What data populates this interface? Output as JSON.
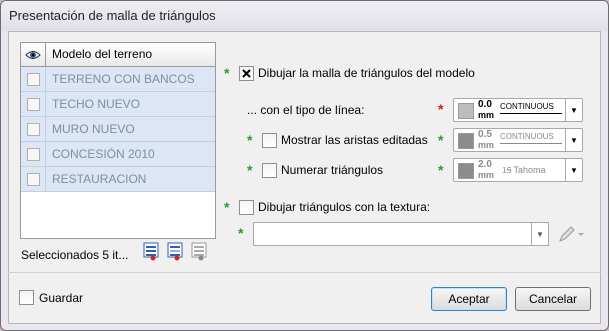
{
  "window": {
    "title": "Presentación de malla de triángulos"
  },
  "table": {
    "header": "Modelo del terreno",
    "rows": [
      {
        "label": "TERRENO CON BANCOS",
        "checked": false
      },
      {
        "label": "TECHO NUEVO",
        "checked": false
      },
      {
        "label": "MURO NUEVO",
        "checked": false
      },
      {
        "label": "CONCESIÓN 2010",
        "checked": false
      },
      {
        "label": "RESTAURACION",
        "checked": false
      }
    ]
  },
  "selection_info": "Seleccionados 5 it...",
  "options": {
    "draw_model": {
      "label": "Dibujar la malla de triángulos del modelo",
      "checked": true
    },
    "line_type": {
      "label": "... con el tipo de línea:"
    },
    "show_edited": {
      "label": "Mostrar las aristas editadas",
      "checked": false
    },
    "number_triangles": {
      "label": "Numerar triángulos",
      "checked": false
    },
    "draw_texture": {
      "label": "Dibujar triángulos con la textura:",
      "checked": false
    }
  },
  "line_selectors": {
    "main": {
      "value": "0.0",
      "unit": "mm",
      "linetype": "CONTINUOUS"
    },
    "edited": {
      "value": "0.5",
      "unit": "mm",
      "linetype": "CONTINUOUS"
    },
    "number": {
      "value": "2.0",
      "unit": "mm",
      "font": "Tahoma"
    }
  },
  "texture": {
    "value": ""
  },
  "footer": {
    "save_label": "Guardar",
    "accept_label": "Aceptar",
    "cancel_label": "Cancelar"
  },
  "colors": {
    "star_green": "#2a9a2a",
    "star_red": "#d21a1a",
    "row_bg": "#dce6f4"
  }
}
